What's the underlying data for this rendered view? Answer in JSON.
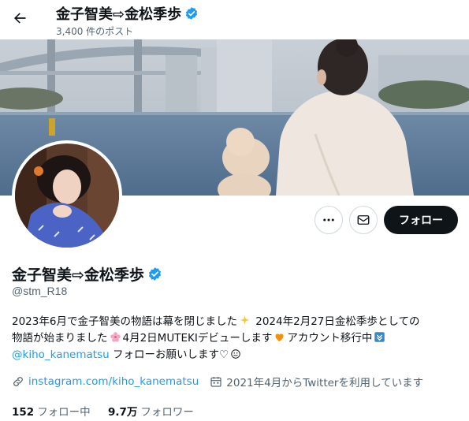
{
  "header": {
    "title": "金子智美⇨金松季歩",
    "post_count": "3,400 件のポスト"
  },
  "profile": {
    "name": "金子智美⇨金松季歩",
    "handle": "@stm_R18",
    "follow_label": "フォロー",
    "bio": {
      "line1_text": "2023年6月で金子智美の物語は幕を閉じました",
      "line1_text_b": " 2024年2月27日金松季歩としての",
      "line2_text_a": "物語が始まりました",
      "line2_text_b": "4月2日MUTEKIデビューします",
      "line2_text_c": "アカウント移行中",
      "line3_mention": "@kiho_kanematsu",
      "line3_text": " フォローお願いします♡",
      "emojis": [
        "sparkles",
        "cherry-blossom",
        "orange-heart",
        "down-arrow-box",
        "smiley"
      ]
    },
    "website": "instagram.com/kiho_kanematsu",
    "joined": "2021年4月からTwitterを利用しています",
    "following_count": "152",
    "following_label": "フォロー中",
    "followers_count": "9.7万",
    "followers_label": "フォロワー"
  },
  "colors": {
    "accent": "#1d9bf0",
    "text": "#0f1419",
    "muted": "#536471",
    "button_dark": "#0f1419",
    "border": "#cfd9de",
    "verified": "#1d9bf0"
  },
  "icons": [
    "back-arrow-icon",
    "verified-icon",
    "more-icon",
    "mail-icon",
    "link-icon",
    "calendar-icon"
  ]
}
